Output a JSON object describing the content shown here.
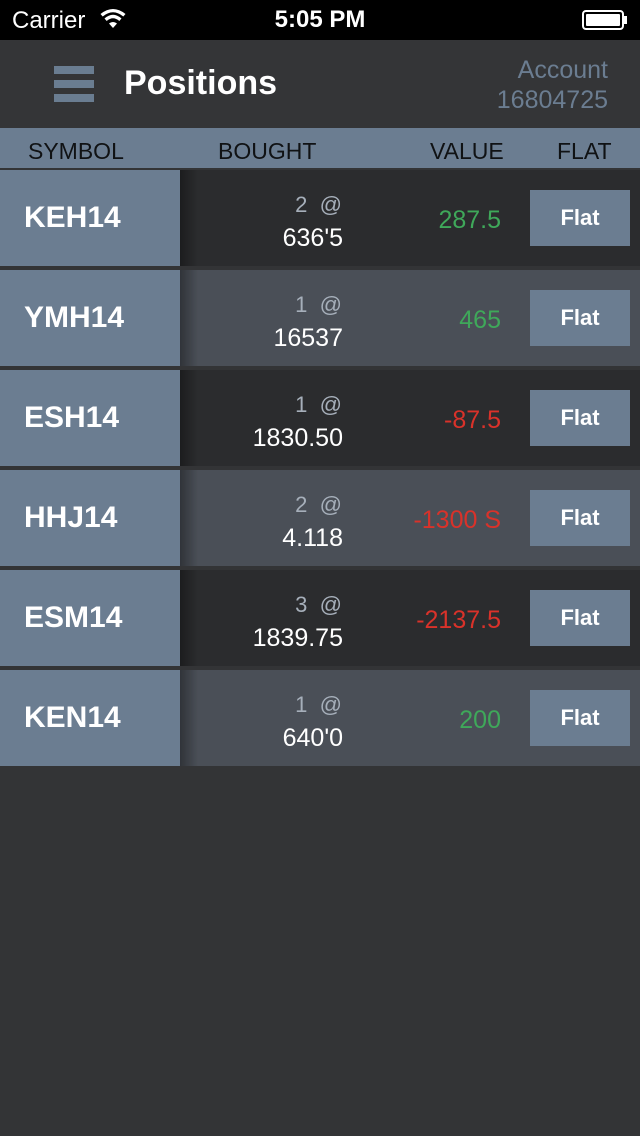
{
  "status_bar": {
    "carrier": "Carrier",
    "time": "5:05 PM"
  },
  "nav": {
    "title": "Positions",
    "account_label": "Account",
    "account_id": "16804725"
  },
  "columns": {
    "symbol": "SYMBOL",
    "bought": "BOUGHT",
    "value": "VALUE",
    "flat": "FLAT"
  },
  "colors": {
    "positive": "#3fa85a",
    "negative": "#d9322a",
    "accent": "#6b7d91"
  },
  "positions": [
    {
      "symbol": "KEH14",
      "qty": "2",
      "at": "@",
      "price": "636'5",
      "value": "287.5",
      "sign": "pos",
      "flat_label": "Flat"
    },
    {
      "symbol": "YMH14",
      "qty": "1",
      "at": "@",
      "price": "16537",
      "value": "465",
      "sign": "pos",
      "flat_label": "Flat"
    },
    {
      "symbol": "ESH14",
      "qty": "1",
      "at": "@",
      "price": "1830.50",
      "value": "-87.5",
      "sign": "neg",
      "flat_label": "Flat"
    },
    {
      "symbol": "HHJ14",
      "qty": "2",
      "at": "@",
      "price": "4.118",
      "value": "-1300 S",
      "sign": "neg",
      "flat_label": "Flat"
    },
    {
      "symbol": "ESM14",
      "qty": "3",
      "at": "@",
      "price": "1839.75",
      "value": "-2137.5",
      "sign": "neg",
      "flat_label": "Flat"
    },
    {
      "symbol": "KEN14",
      "qty": "1",
      "at": "@",
      "price": "640'0",
      "value": "200",
      "sign": "pos",
      "flat_label": "Flat"
    }
  ]
}
